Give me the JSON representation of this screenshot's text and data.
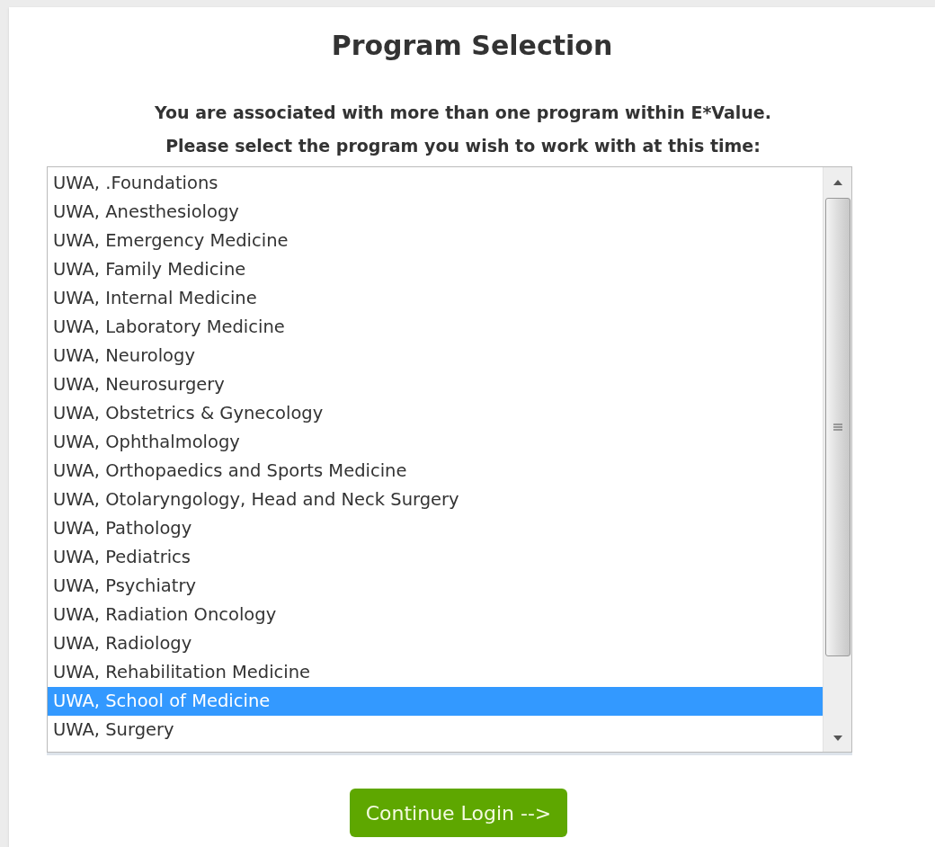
{
  "title": "Program Selection",
  "instructions": [
    "You are associated with more than one program within E*Value.",
    "Please select the program you wish to work with at this time:"
  ],
  "programs": [
    {
      "label": "UWA, .Foundations",
      "selected": false
    },
    {
      "label": "UWA, Anesthesiology",
      "selected": false
    },
    {
      "label": "UWA, Emergency Medicine",
      "selected": false
    },
    {
      "label": "UWA, Family Medicine",
      "selected": false
    },
    {
      "label": "UWA, Internal Medicine",
      "selected": false
    },
    {
      "label": "UWA, Laboratory Medicine",
      "selected": false
    },
    {
      "label": "UWA, Neurology",
      "selected": false
    },
    {
      "label": "UWA, Neurosurgery",
      "selected": false
    },
    {
      "label": "UWA, Obstetrics & Gynecology",
      "selected": false
    },
    {
      "label": "UWA, Ophthalmology",
      "selected": false
    },
    {
      "label": "UWA, Orthopaedics and Sports Medicine",
      "selected": false
    },
    {
      "label": "UWA, Otolaryngology, Head and Neck Surgery",
      "selected": false
    },
    {
      "label": "UWA, Pathology",
      "selected": false
    },
    {
      "label": "UWA, Pediatrics",
      "selected": false
    },
    {
      "label": "UWA, Psychiatry",
      "selected": false
    },
    {
      "label": "UWA, Radiation Oncology",
      "selected": false
    },
    {
      "label": "UWA, Radiology",
      "selected": false
    },
    {
      "label": "UWA, Rehabilitation Medicine",
      "selected": false
    },
    {
      "label": "UWA, School of Medicine",
      "selected": true
    },
    {
      "label": "UWA, Surgery",
      "selected": false
    }
  ],
  "button": "Continue Login -->"
}
